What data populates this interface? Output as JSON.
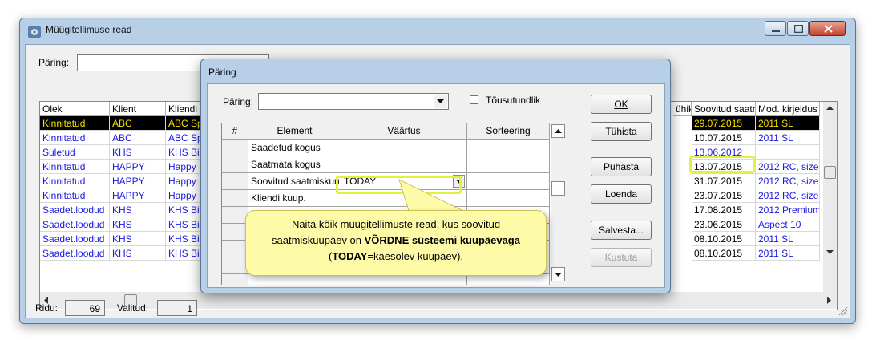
{
  "main_window": {
    "title": "Müügitellimuse read",
    "query_label": "Päring:",
    "columns": [
      "Olek",
      "Klient",
      "Kliendi",
      "ühik",
      "Soovitud saatm",
      "Mod. kirjeldus"
    ],
    "rows": [
      {
        "olek": "Kinnitatud",
        "klient": "ABC",
        "kliendi": "ABC Sp",
        "soovitud": "29.07.2015",
        "mod": "2011 SL",
        "selected": true
      },
      {
        "olek": "Kinnitatud",
        "klient": "ABC",
        "kliendi": "ABC Sp",
        "soovitud": "10.07.2015",
        "mod": "2011 SL",
        "selected": false
      },
      {
        "olek": "Suletud",
        "klient": "KHS",
        "kliendi": "KHS Bi",
        "soovitud": "13.06.2012",
        "mod": "",
        "selected": false
      },
      {
        "olek": "Kinnitatud",
        "klient": "HAPPY",
        "kliendi": "Happy",
        "soovitud": "13.07.2015",
        "mod": "2012 RC, size",
        "selected": false
      },
      {
        "olek": "Kinnitatud",
        "klient": "HAPPY",
        "kliendi": "Happy",
        "soovitud": "31.07.2015",
        "mod": "2012 RC, size",
        "selected": false
      },
      {
        "olek": "Kinnitatud",
        "klient": "HAPPY",
        "kliendi": "Happy",
        "soovitud": "23.07.2015",
        "mod": "2012 RC, size",
        "selected": false
      },
      {
        "olek": "Saadet.loodud",
        "klient": "KHS",
        "kliendi": "KHS Bi",
        "soovitud": "17.08.2015",
        "mod": "2012 Premium",
        "selected": false
      },
      {
        "olek": "Saadet.loodud",
        "klient": "KHS",
        "kliendi": "KHS Bi",
        "soovitud": "23.06.2015",
        "mod": "Aspect 10",
        "selected": false
      },
      {
        "olek": "Saadet.loodud",
        "klient": "KHS",
        "kliendi": "KHS Bi",
        "soovitud": "08.10.2015",
        "mod": "2011 SL",
        "selected": false
      },
      {
        "olek": "Saadet.loodud",
        "klient": "KHS",
        "kliendi": "KHS Bi",
        "soovitud": "08.10.2015",
        "mod": "2011 SL",
        "selected": false
      }
    ],
    "footer": {
      "ridu_label": "Ridu:",
      "ridu_value": "69",
      "valitud_label": "Valitud:",
      "valitud_value": "1"
    }
  },
  "dialog": {
    "title": "Päring",
    "query_label": "Päring:",
    "ascending_label": "Tõusutundlik",
    "ascending_checked": false,
    "columns": [
      "#",
      "Element",
      "Väärtus",
      "Sorteering"
    ],
    "rows": [
      {
        "element": "Saadetud kogus",
        "value": ""
      },
      {
        "element": "Saatmata kogus",
        "value": ""
      },
      {
        "element": "Soovitud saatmiskuu",
        "value": "TODAY"
      },
      {
        "element": "Kliendi kuup.",
        "value": ""
      }
    ],
    "buttons": {
      "ok": "OK",
      "cancel": "Tühista",
      "clear": "Puhasta",
      "list": "Loenda",
      "save": "Salvesta...",
      "delete": "Kustuta"
    }
  },
  "callout": {
    "line1": "Näita kõik müügitellimuste read, kus soovitud",
    "line2_a": "saatmiskuupäev on ",
    "line2_b": "VÕRDNE süsteemi kuupäevaga",
    "line3_a": "(",
    "line3_b": "TODAY",
    "line3_c": "=käesolev kuupäev)."
  },
  "colors": {
    "highlight": "#e2f23a",
    "callout_bg": "#fdfba8",
    "selected_text": "#f5e000",
    "link_blue": "#1a1ae0"
  }
}
